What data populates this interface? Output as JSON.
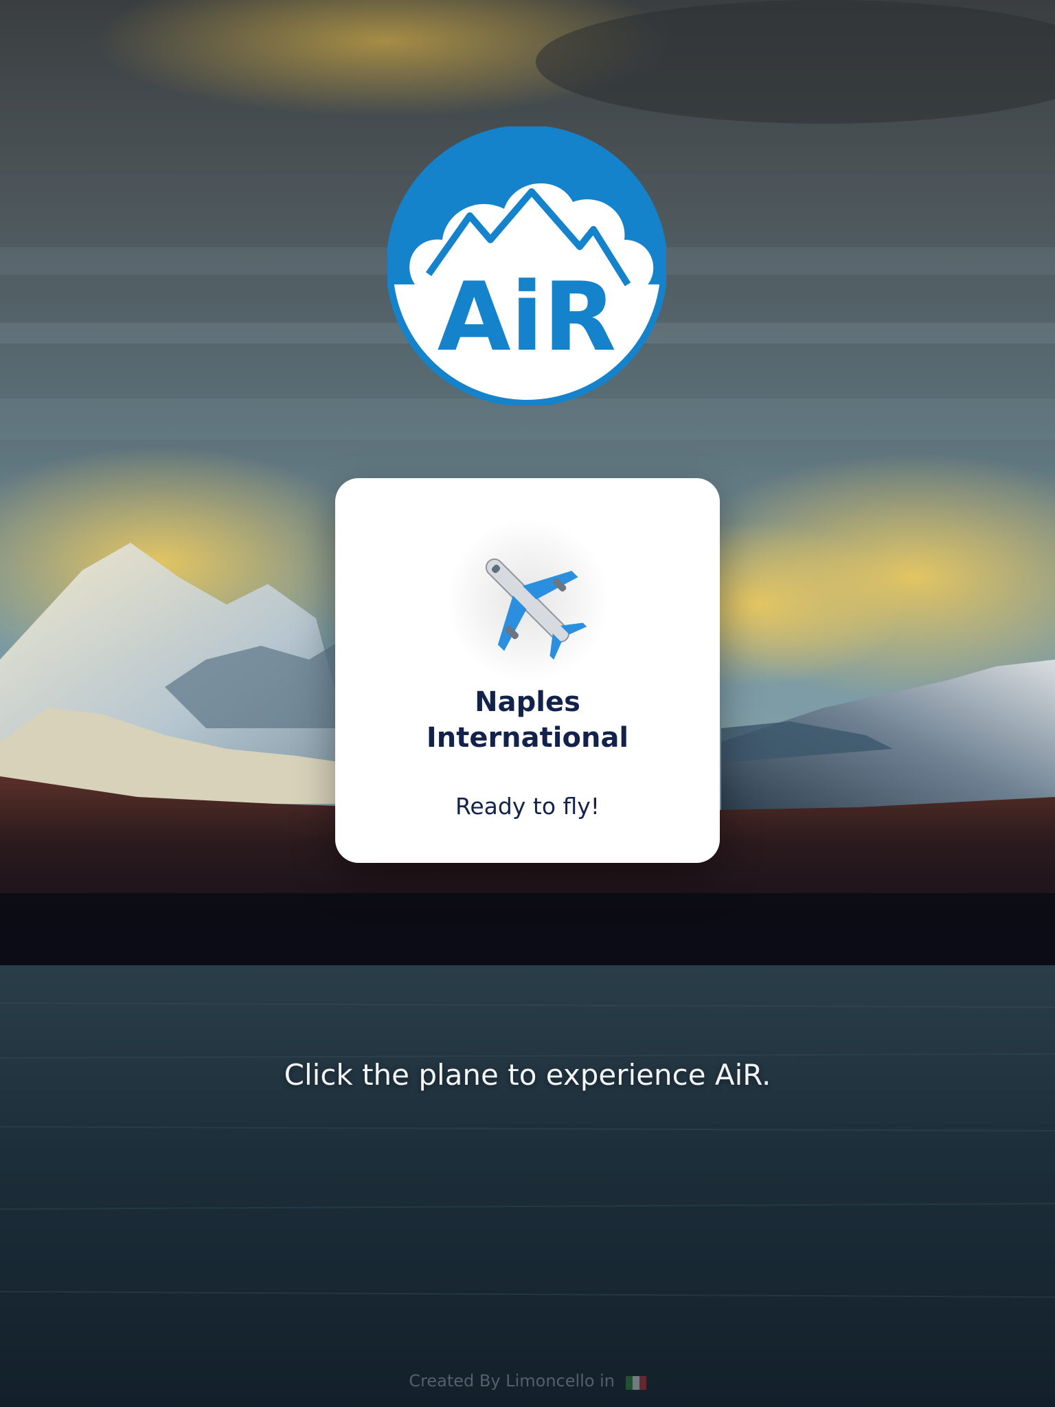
{
  "logo": {
    "text": "AiR",
    "brand_color": "#1583cc"
  },
  "card": {
    "icon": "airplane-icon",
    "title": "Naples\nInternational",
    "status": "Ready to fly!"
  },
  "hint": "Click the plane to experience AiR.",
  "footer": {
    "text": "Created By Limoncello in",
    "flag_icon": "italy-flag-icon"
  },
  "colors": {
    "title_text": "#12224a",
    "card_bg": "#ffffff",
    "hint_text": "#f2f4f7"
  }
}
